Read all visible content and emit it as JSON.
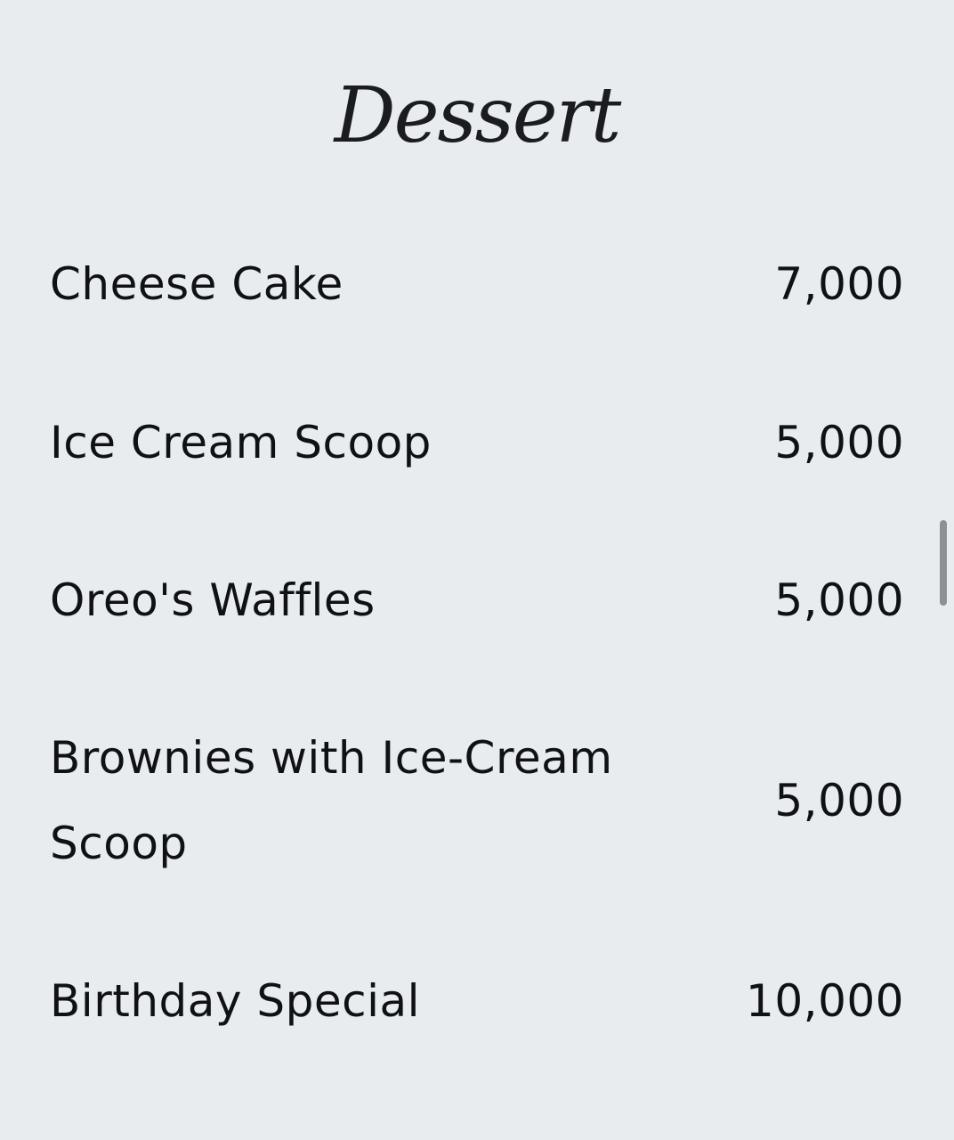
{
  "page": {
    "section_title": "Dessert"
  },
  "menu": {
    "items": [
      {
        "name": "Cheese Cake",
        "price": "7,000"
      },
      {
        "name": "Ice Cream Scoop",
        "price": "5,000"
      },
      {
        "name": "Oreo's Waffles",
        "price": "5,000"
      },
      {
        "name": "Brownies with Ice-Cream Scoop",
        "price": "5,000"
      },
      {
        "name": "Birthday Special",
        "price": "10,000"
      }
    ]
  },
  "colors": {
    "background": "#e8ecef",
    "text": "#0f1114",
    "scrollbar": "#8d9196"
  }
}
